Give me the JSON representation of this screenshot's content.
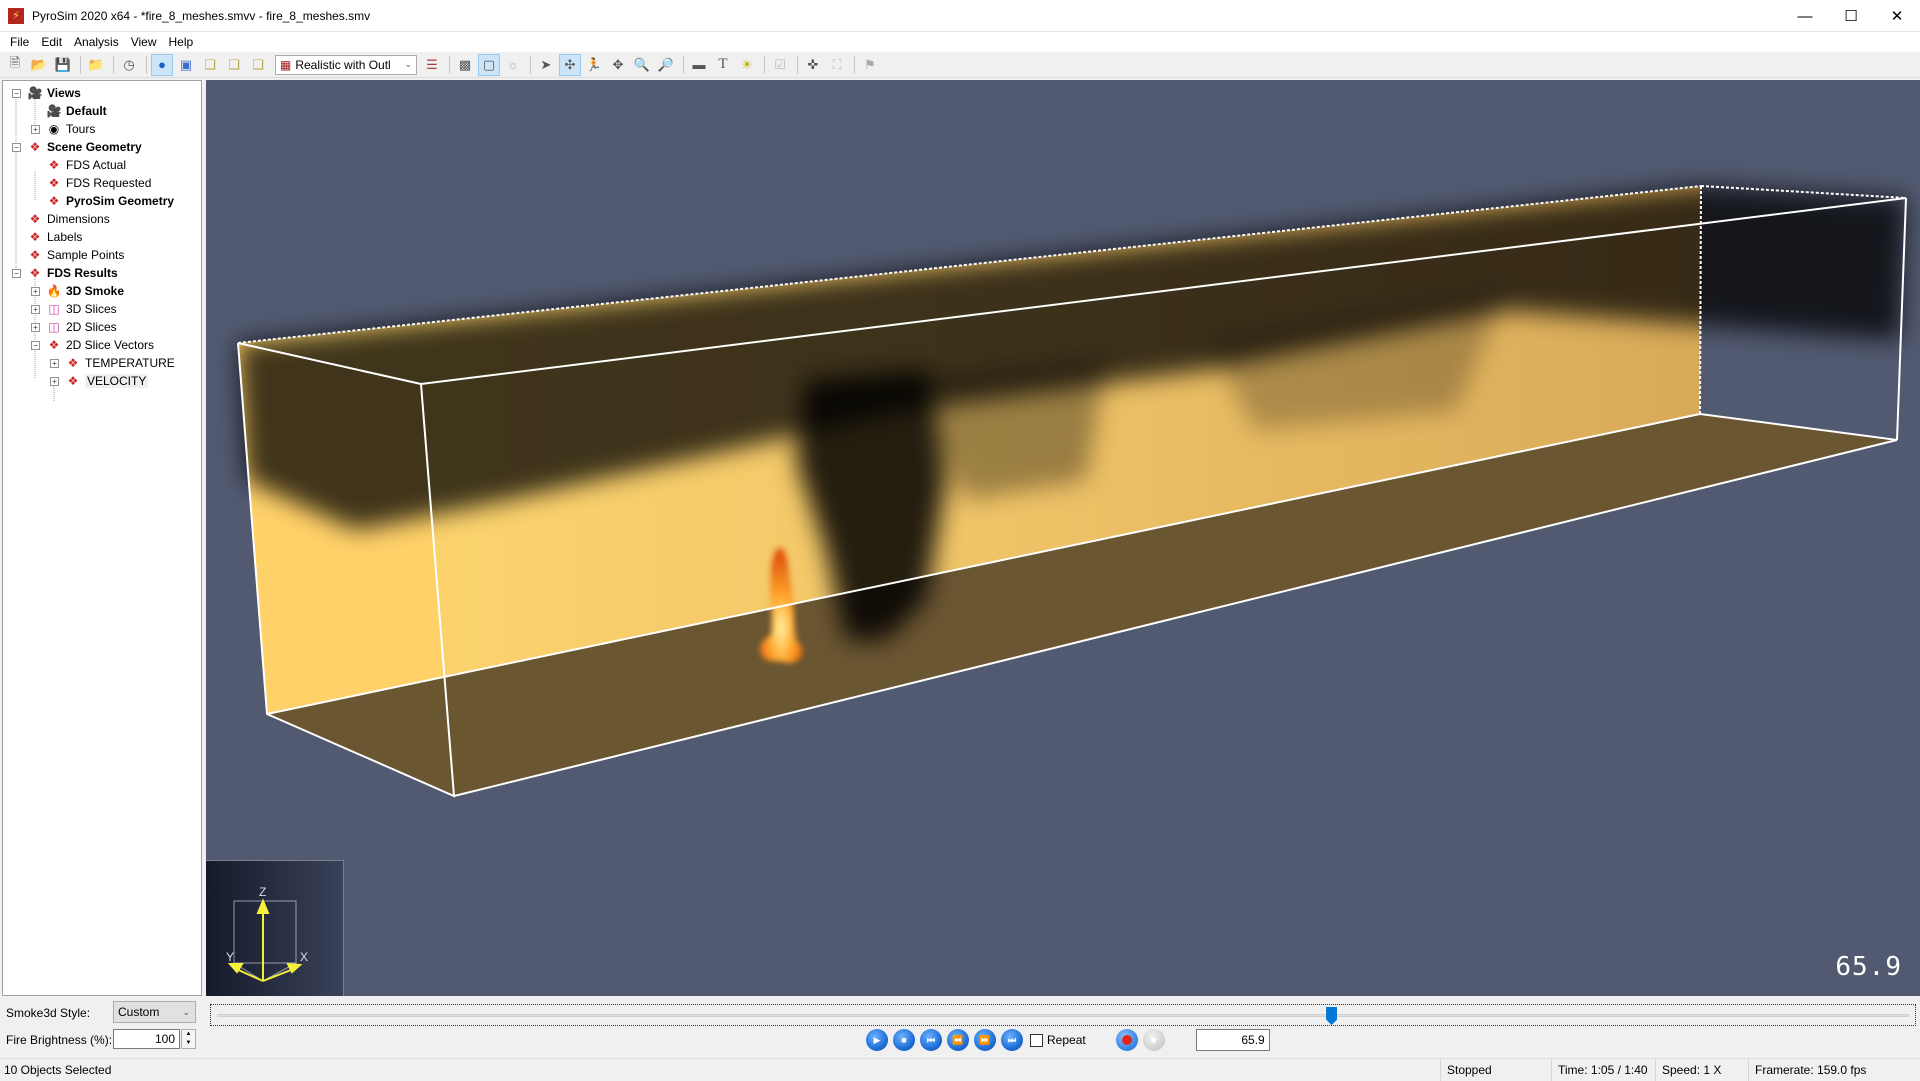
{
  "window": {
    "title": "PyroSim 2020 x64 - *fire_8_meshes.smvv - fire_8_meshes.smv",
    "app_icon": "pyrosim-logo-icon",
    "controls": [
      "minimize",
      "maximize",
      "close"
    ]
  },
  "menu": [
    {
      "label": "File",
      "accel": "F"
    },
    {
      "label": "Edit",
      "accel": "E"
    },
    {
      "label": "Analysis",
      "accel": "n"
    },
    {
      "label": "View",
      "accel": "V"
    },
    {
      "label": "Help",
      "accel": "H"
    }
  ],
  "toolbar": {
    "render_mode": "Realistic with Outl",
    "buttons": [
      "new-file",
      "open-file",
      "save-file",
      "open-results",
      "clock",
      "view-reset",
      "view-front",
      "view-top",
      "view-side",
      "view-iso",
      "render-mode",
      "color-settings",
      "show-geometry",
      "show-outline",
      "show-lights",
      "select",
      "orbit",
      "walk",
      "pan",
      "zoom",
      "zoom-box",
      "measure",
      "text",
      "light",
      "checklist",
      "center",
      "frame",
      "record-camera"
    ]
  },
  "tree": [
    {
      "label": "Views",
      "bold": true,
      "icon": "camera-icon",
      "level": 0,
      "expander": "minus"
    },
    {
      "label": "Default",
      "bold": true,
      "icon": "camera-icon",
      "level": 1
    },
    {
      "label": "Tours",
      "bold": false,
      "icon": "tour-icon",
      "level": 1,
      "expander": "plus"
    },
    {
      "label": "Scene Geometry",
      "bold": true,
      "icon": "cubes-icon",
      "level": 0,
      "expander": "minus"
    },
    {
      "label": "FDS Actual",
      "bold": false,
      "icon": "cubes-icon",
      "level": 1
    },
    {
      "label": "FDS Requested",
      "bold": false,
      "icon": "cubes-icon",
      "level": 1
    },
    {
      "label": "PyroSim Geometry",
      "bold": true,
      "icon": "cubes-icon",
      "level": 1
    },
    {
      "label": "Dimensions",
      "bold": false,
      "icon": "cubes-icon",
      "level": 0
    },
    {
      "label": "Labels",
      "bold": false,
      "icon": "cubes-icon",
      "level": 0
    },
    {
      "label": "Sample Points",
      "bold": false,
      "icon": "cubes-icon",
      "level": 0
    },
    {
      "label": "FDS Results",
      "bold": true,
      "icon": "cubes-icon",
      "level": 0,
      "expander": "minus"
    },
    {
      "label": "3D Smoke",
      "bold": true,
      "icon": "flame-icon",
      "level": 1,
      "expander": "plus"
    },
    {
      "label": "3D Slices",
      "bold": false,
      "icon": "slice3d-icon",
      "level": 1,
      "expander": "plus"
    },
    {
      "label": "2D Slices",
      "bold": false,
      "icon": "slice2d-icon",
      "level": 1,
      "expander": "plus"
    },
    {
      "label": "2D Slice Vectors",
      "bold": false,
      "icon": "cubes-icon",
      "level": 1,
      "expander": "minus"
    },
    {
      "label": "TEMPERATURE",
      "bold": false,
      "icon": "cubes-icon",
      "level": 2,
      "expander": "plus"
    },
    {
      "label": "VELOCITY",
      "bold": false,
      "icon": "cubes-icon",
      "level": 2,
      "expander": "plus",
      "selected": true
    }
  ],
  "viewport": {
    "time_readout": "65.9",
    "axes": {
      "z": "Z",
      "y": "Y",
      "x": "X"
    },
    "colors": {
      "background": "#525a71",
      "wall": "#f2c66a",
      "floor": "#6a5531",
      "outline": "#ffffff",
      "smoke": "#000000",
      "fire": "#ff8a1a"
    }
  },
  "controls": {
    "smoke_style_label": "Smoke3d Style:",
    "smoke_style_value": "Custom",
    "fire_brightness_label": "Fire Brightness (%):",
    "fire_brightness_value": "100"
  },
  "playback": {
    "repeat_label": "Repeat",
    "repeat_checked": false,
    "time_value": "65.9",
    "timeline_fraction": 0.659,
    "buttons": [
      "play",
      "stop",
      "skip-start",
      "rewind",
      "fast-forward",
      "skip-end"
    ]
  },
  "status": {
    "selection": "10 Objects Selected",
    "state": "Stopped",
    "time": "Time: 1:05 / 1:40",
    "speed": "Speed: 1 X",
    "framerate": "Framerate: 159.0 fps"
  }
}
